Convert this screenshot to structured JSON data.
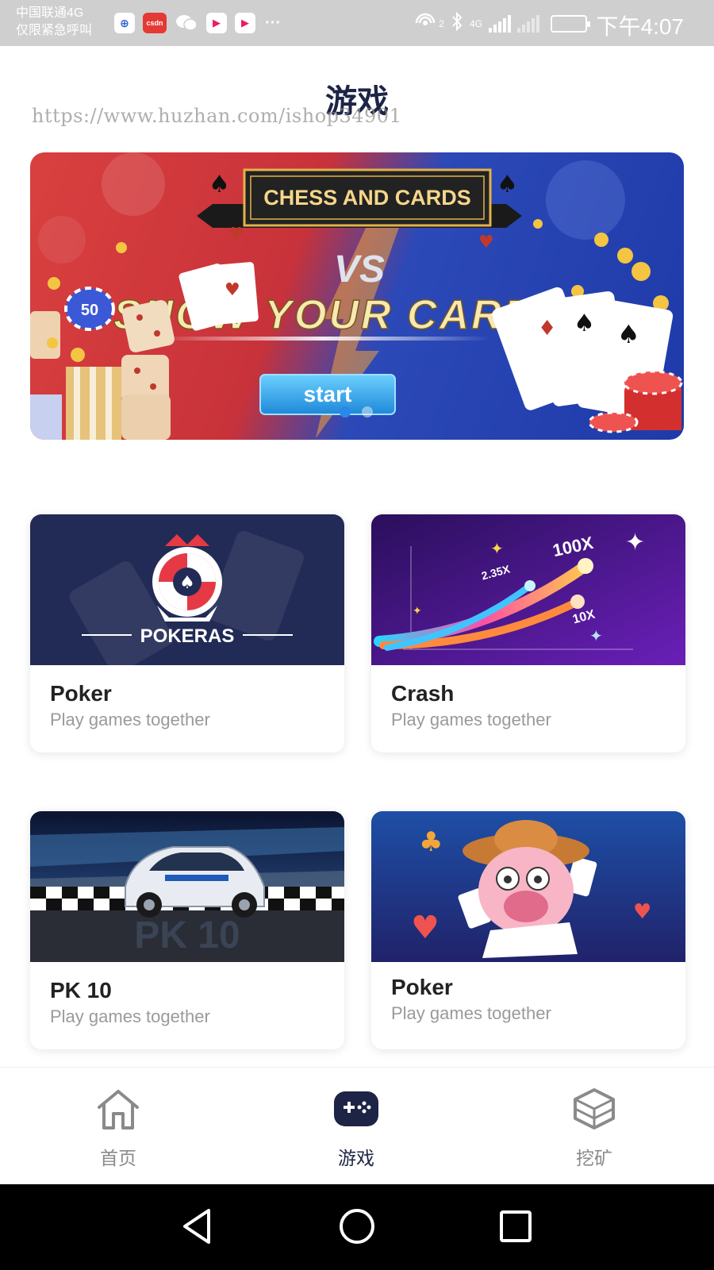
{
  "status_bar": {
    "carrier_line1": "中国联通4G",
    "carrier_line2": "仅限紧急呼叫",
    "notification_icons": [
      "cmb-app-icon",
      "csdn-app-icon",
      "wechat-icon",
      "youku-app-icon",
      "youku-app-icon"
    ],
    "csdn_label": "csdn",
    "more_label": "···",
    "hotspot_superscript": "2",
    "network_label": "4G",
    "time": "下午4:07"
  },
  "header": {
    "title": "游戏",
    "watermark": "https://www.huzhan.com/ishop34901"
  },
  "banner": {
    "ribbon_text": "CHESS AND CARDS",
    "vs_text": "VS",
    "headline": "SHOW YOUR CARDS",
    "button_label": "start",
    "chip_value": "50",
    "slide_count": 2,
    "active_slide": 0,
    "colors": {
      "left": "#d9403f",
      "right": "#1e3aa8",
      "button": "#3aa8e8"
    }
  },
  "games": [
    {
      "title": "Poker",
      "subtitle": "Play games together",
      "art_text": "POKERAS"
    },
    {
      "title": "Crash",
      "subtitle": "Play games together",
      "art_labels": [
        "2.35X",
        "100X",
        "10X"
      ]
    },
    {
      "title": "PK 10",
      "subtitle": "Play games together",
      "art_text": "PK 10"
    },
    {
      "title": "Poker",
      "subtitle": "Play games together"
    }
  ],
  "tabbar": {
    "items": [
      {
        "label": "首页",
        "icon": "home-icon",
        "active": false
      },
      {
        "label": "游戏",
        "icon": "gamepad-icon",
        "active": true
      },
      {
        "label": "挖矿",
        "icon": "cube-icon",
        "active": false
      }
    ],
    "colors": {
      "active": "#1d2446",
      "inactive": "#8a8a8a"
    }
  },
  "android_nav": {
    "buttons": [
      "back-icon",
      "home-circle-icon",
      "recents-icon"
    ]
  }
}
